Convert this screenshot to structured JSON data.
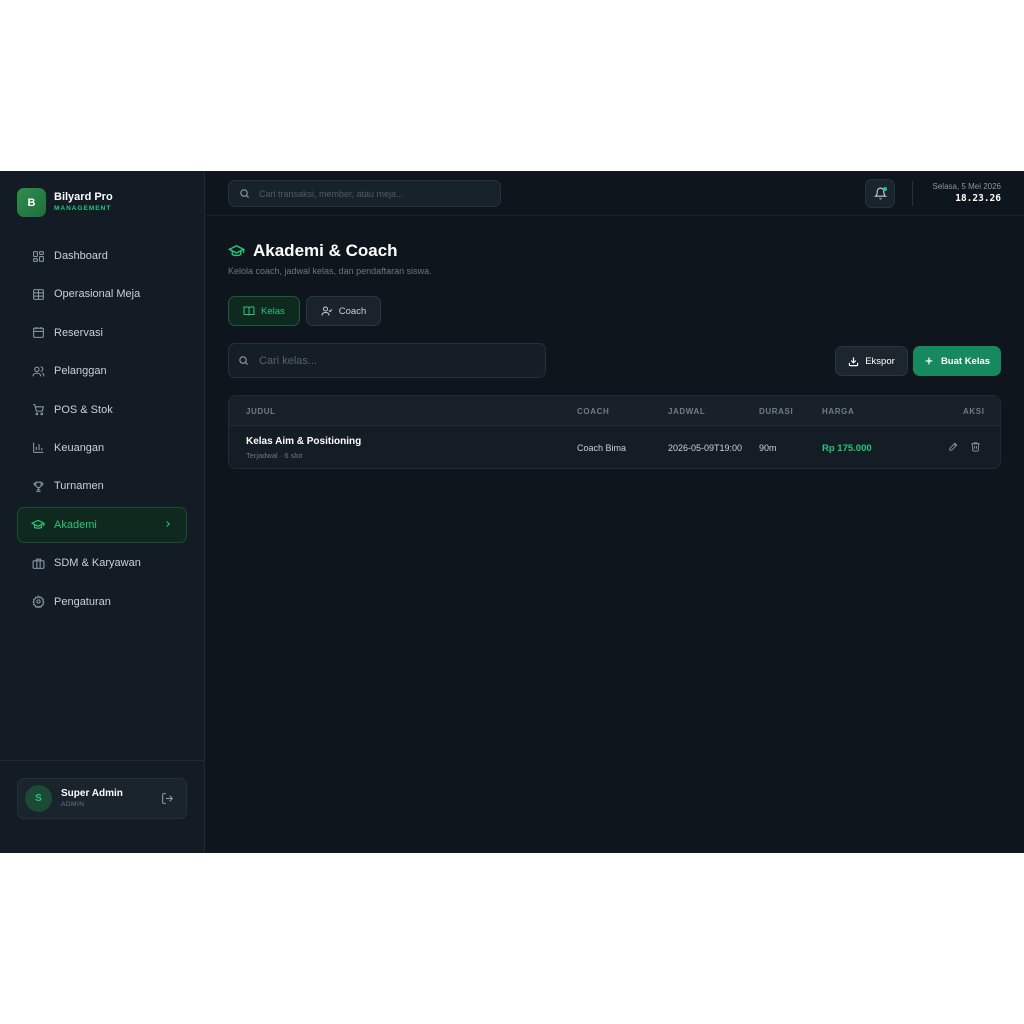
{
  "brand": {
    "initial": "B",
    "name": "Bilyard Pro",
    "subtitle": "MANAGEMENT"
  },
  "sidebar": {
    "items": [
      {
        "label": "Dashboard",
        "icon": "grid-icon"
      },
      {
        "label": "Operasional Meja",
        "icon": "table-icon"
      },
      {
        "label": "Reservasi",
        "icon": "calendar-icon"
      },
      {
        "label": "Pelanggan",
        "icon": "users-icon"
      },
      {
        "label": "POS & Stok",
        "icon": "cart-icon"
      },
      {
        "label": "Keuangan",
        "icon": "bar-chart-icon"
      },
      {
        "label": "Turnamen",
        "icon": "trophy-icon"
      },
      {
        "label": "Akademi",
        "icon": "graduation-cap-icon",
        "active": true
      },
      {
        "label": "SDM & Karyawan",
        "icon": "briefcase-icon"
      },
      {
        "label": "Pengaturan",
        "icon": "gear-icon"
      }
    ]
  },
  "user": {
    "initial": "S",
    "name": "Super Admin",
    "role": "ADMIN"
  },
  "topbar": {
    "search_placeholder": "Cari transaksi, member, atau meja...",
    "date": "Selasa, 5 Mei 2026",
    "time": "18.23.26"
  },
  "page": {
    "title": "Akademi & Coach",
    "subtitle": "Kelola coach, jadwal kelas, dan pendaftaran siswa."
  },
  "tabs": [
    {
      "label": "Kelas",
      "active": true
    },
    {
      "label": "Coach",
      "active": false
    }
  ],
  "toolbar": {
    "search_placeholder": "Cari kelas...",
    "export_label": "Ekspor",
    "create_label": "Buat Kelas"
  },
  "table": {
    "headers": [
      "JUDUL",
      "COACH",
      "JADWAL",
      "DURASI",
      "HARGA",
      "AKSI"
    ],
    "rows": [
      {
        "title": "Kelas Aim & Positioning",
        "status": "Terjadwal · 6 slot",
        "coach": "Coach Bima",
        "schedule": "2026-05-09T19:00",
        "duration": "90m",
        "price": "Rp 175.000"
      }
    ]
  },
  "colors": {
    "accent": "#22c77a",
    "background": "#0f151c",
    "sidebar": "#131c24",
    "primary_button": "#168a5e"
  }
}
